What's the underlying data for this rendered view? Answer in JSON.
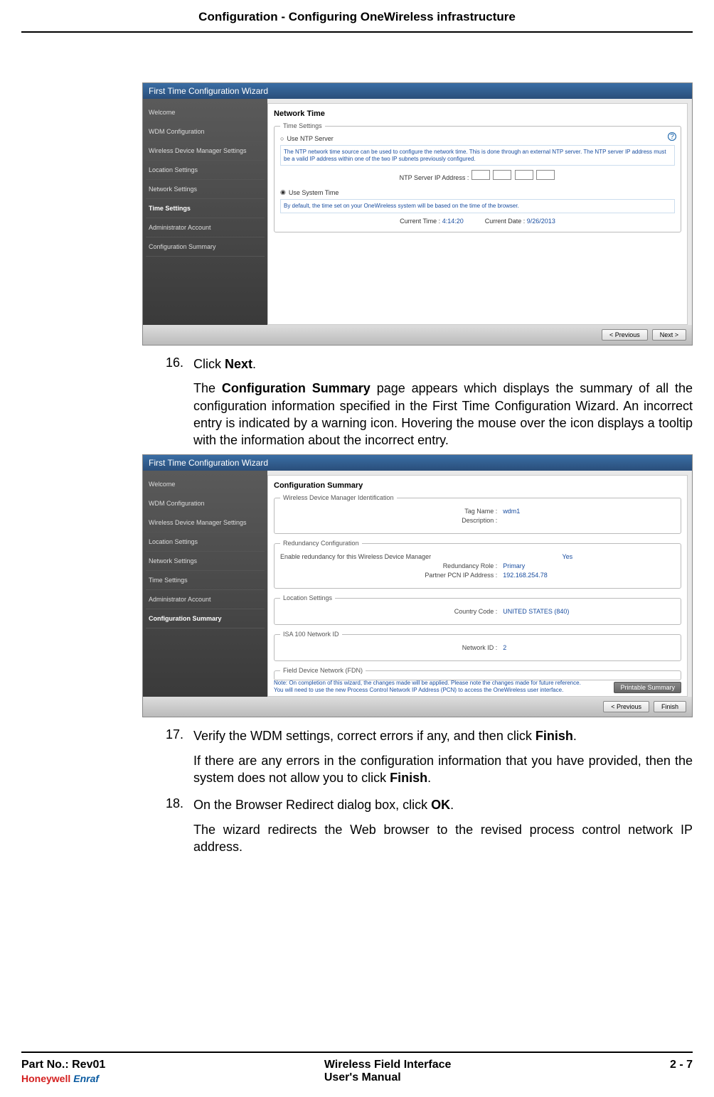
{
  "header": {
    "title": "Configuration - Configuring OneWireless infrastructure"
  },
  "wizard1": {
    "title": "First Time Configuration Wizard",
    "sidebar": [
      "Welcome",
      "WDM Configuration",
      "Wireless Device Manager Settings",
      "Location Settings",
      "Network Settings",
      "Time Settings",
      "Administrator Account",
      "Configuration Summary"
    ],
    "activeIndex": "5",
    "panelTitle": "Network Time",
    "fs1_legend": "Time Settings",
    "radioNtp": "Use NTP Server",
    "ntpInfo": "The NTP network time source can be used to configure the network time. This is done through an external NTP server. The NTP server IP address must be a valid IP address within one of the two IP subnets previously configured.",
    "ntpLabel": "NTP Server IP Address :",
    "radioSystem": "Use System Time",
    "sysInfo": "By default, the time set on your OneWireless system will be based on the time of the browser.",
    "timeLabel": "Current Time :",
    "timeValue": "4:14:20",
    "dateLabel": "Current Date :",
    "dateValue": "9/26/2013",
    "btnPrev": "< Previous",
    "btnNext": "Next >"
  },
  "step16": {
    "num": "16.",
    "text1": "Click ",
    "bold1": "Next",
    "text2": ".",
    "para2a": "The ",
    "bold2": "Configuration Summary",
    "para2b": " page appears which displays the summary of all the configuration information specified in the First Time Configuration Wizard. An incorrect entry is indicated by a warning icon. Hovering the mouse over the icon displays a tooltip with the information about the incorrect entry."
  },
  "wizard2": {
    "title": "First Time Configuration Wizard",
    "sidebar": [
      "Welcome",
      "WDM Configuration",
      "Wireless Device Manager Settings",
      "Location Settings",
      "Network Settings",
      "Time Settings",
      "Administrator Account",
      "Configuration Summary"
    ],
    "activeIndex": "7",
    "panelTitle": "Configuration Summary",
    "group1": "Wireless Device Manager Identification",
    "tagLabel": "Tag Name :",
    "tagValue": "wdm1",
    "descLabel": "Description :",
    "group2": "Redundancy Configuration",
    "redEnableLabel": "Enable redundancy for this Wireless Device Manager",
    "redEnableValue": "Yes",
    "roleLabel": "Redundancy Role :",
    "roleValue": "Primary",
    "partnerLabel": "Partner PCN IP Address :",
    "partnerValue": "192.168.254.78",
    "group3": "Location Settings",
    "countryLabel": "Country Code :",
    "countryValue": "UNITED STATES (840)",
    "group4": "ISA 100 Network ID",
    "netIdLabel": "Network ID :",
    "netIdValue": "2",
    "group5": "Field Device Network (FDN)",
    "note": "Note: On completion of this wizard, the changes made will be applied. Please note the changes made for future reference. You will need to use the new Process Control Network IP Address (PCN) to access the OneWireless user interface.",
    "printable": "Printable Summary",
    "btnPrev": "< Previous",
    "btnFinish": "Finish"
  },
  "step17": {
    "num": "17.",
    "text1": "Verify the WDM settings, correct errors if any, and then click ",
    "bold1": "Finish",
    "text2": ".",
    "para2a": "If there are any errors in the configuration information that you have provided, then the system does not allow you to click ",
    "bold2": "Finish",
    "para2b": "."
  },
  "step18": {
    "num": "18.",
    "text1": "On the Browser Redirect dialog box, click ",
    "bold1": "OK",
    "text2": ".",
    "para2": "The wizard redirects the Web browser to the revised process control network IP address."
  },
  "footer": {
    "partNo": "Part No.: Rev01",
    "brandHw": "Honeywell",
    "brandEnraf": "Enraf",
    "centerLine1": "Wireless Field Interface",
    "centerLine2": "User's Manual",
    "pageNum": "2 - 7"
  }
}
